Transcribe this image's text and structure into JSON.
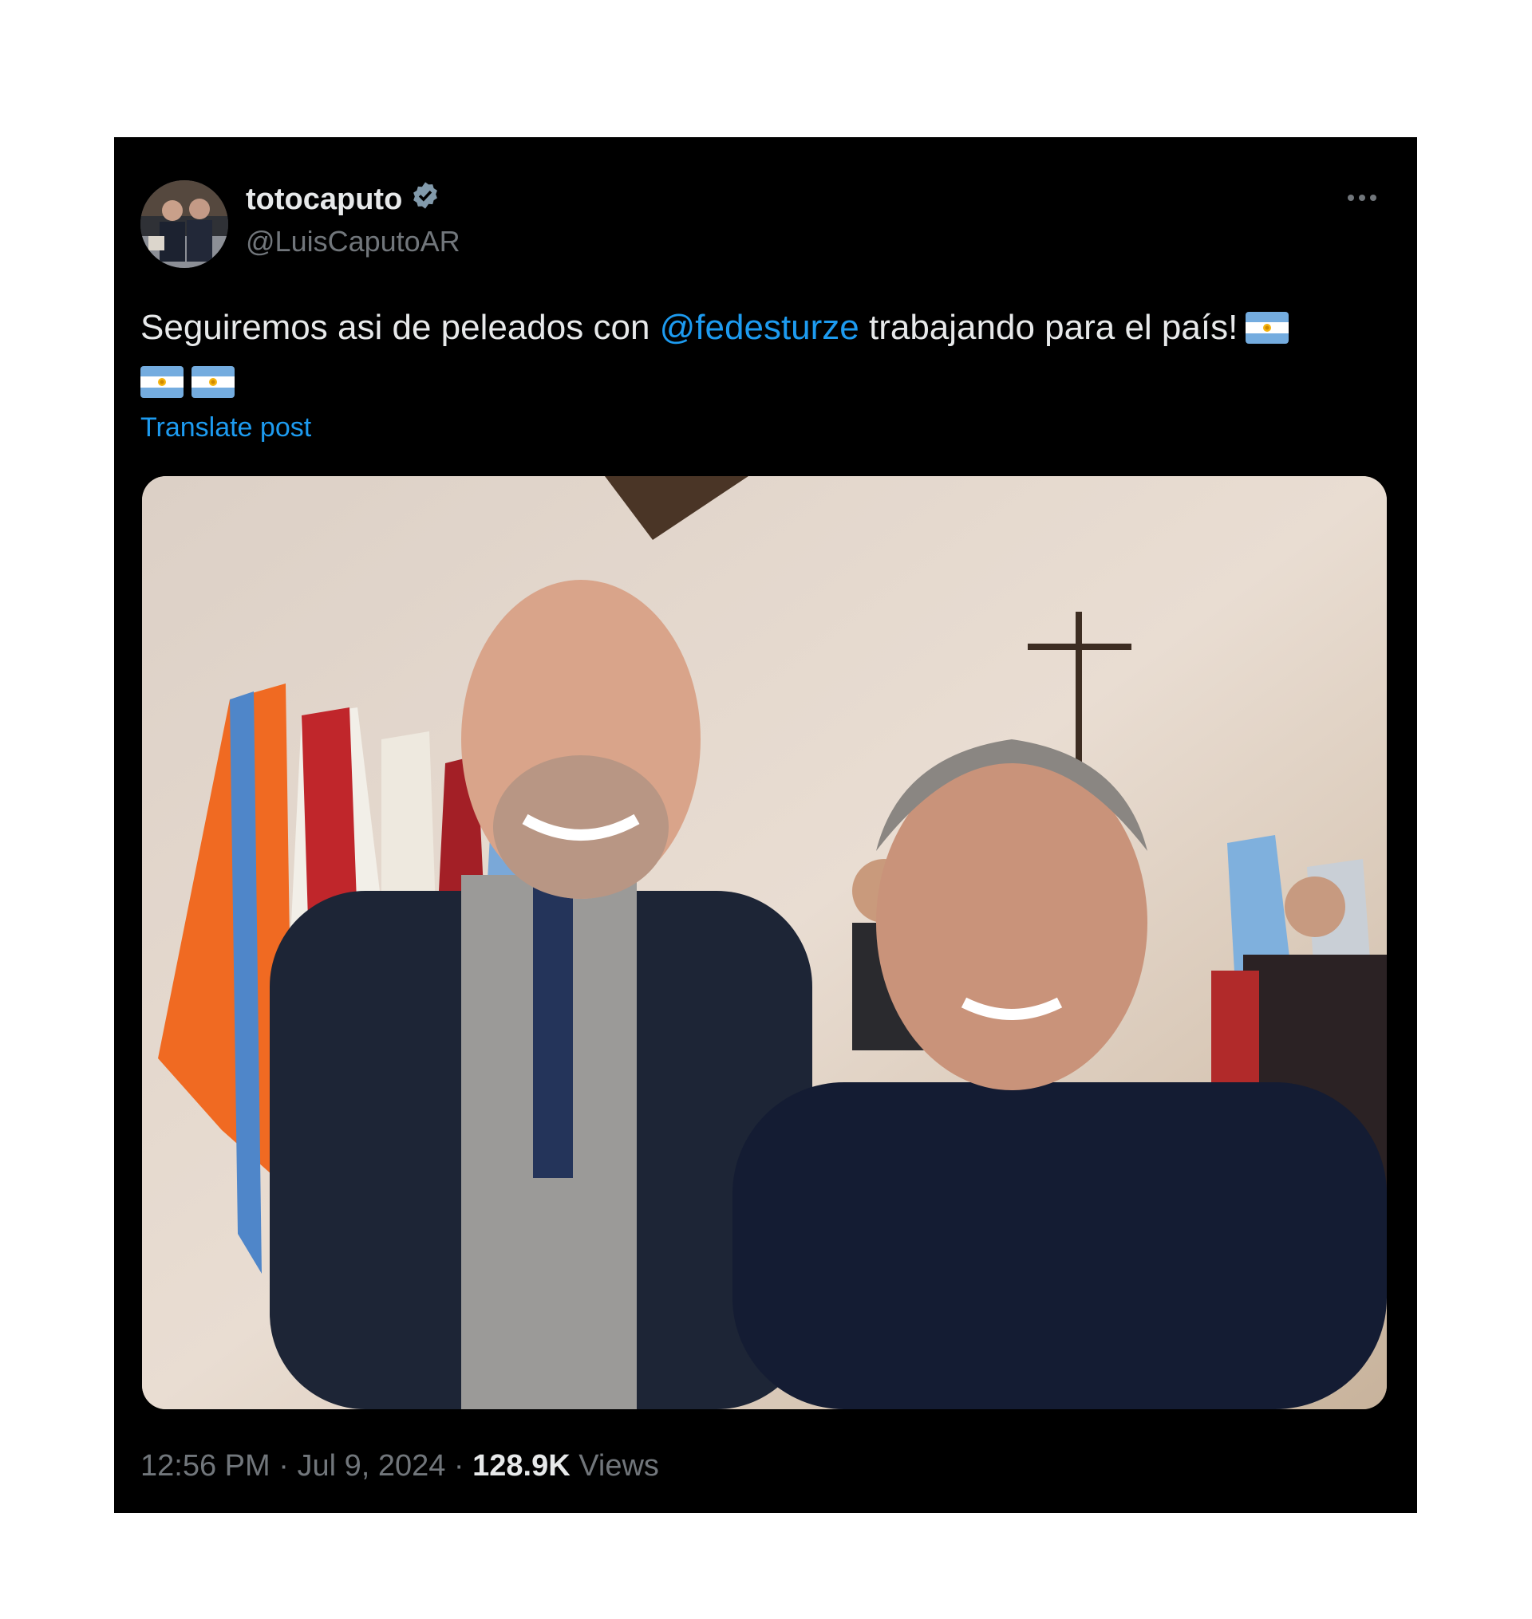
{
  "post": {
    "display_name": "totocaputo",
    "handle": "@LuisCaputoAR",
    "verified_icon": "verified-badge-icon",
    "more_icon": "more-options-icon",
    "text_before": "Seguiremos asi de peleados con ",
    "mention": "@fedesturze",
    "text_after": " trabajando para el país!",
    "emoji": "flag-argentina-icon",
    "translate_label": "Translate post",
    "time": "12:56 PM",
    "separator": "·",
    "date": "Jul 9, 2024",
    "views_count": "128.9K",
    "views_label": "Views"
  },
  "colors": {
    "card_background": "#000000",
    "primary_text": "#e7e9ea",
    "secondary_text": "#71767b",
    "link": "#1d9bf0",
    "verified_badge": "#829aab"
  }
}
